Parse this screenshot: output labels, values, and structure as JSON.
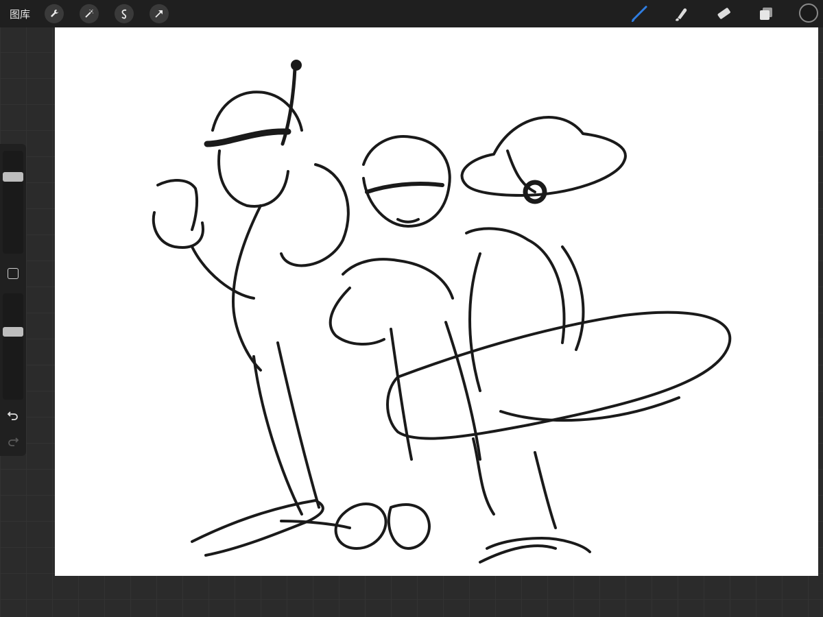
{
  "topbar": {
    "gallery_label": "图库",
    "left_tools": [
      "wrench-icon",
      "magic-wand-icon",
      "selection-icon",
      "transform-arrow-icon"
    ],
    "right_tools": [
      "brush-icon",
      "smudge-icon",
      "eraser-icon",
      "layers-icon"
    ],
    "active_tool": "brush-icon",
    "accent_color": "#2f7de1",
    "current_color": "#1a1a1a"
  },
  "sidebar": {
    "brush_size_level": 0.77,
    "opacity_level": 0.65,
    "modify_icon": "square-icon",
    "undo_icon": "undo-icon",
    "redo_icon": "redo-icon"
  },
  "canvas": {
    "background": "#ffffff",
    "stroke_color": "#1a1a1a"
  }
}
